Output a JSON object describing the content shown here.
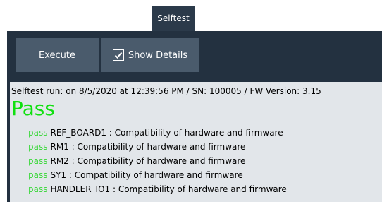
{
  "tab": {
    "label": "Selftest"
  },
  "toolbar": {
    "execute_label": "Execute",
    "show_details_label": "Show Details",
    "show_details_checked": true
  },
  "result": {
    "run_info": "Selftest run: on 8/5/2020 at 12:39:56 PM / SN: 100005 / FW Version: 3.15",
    "verdict": "Pass",
    "verdict_color": "#10e010",
    "items": [
      {
        "status": "pass",
        "text": "REF_BOARD1 : Compatibility of hardware and firmware"
      },
      {
        "status": "pass",
        "text": "RM1 : Compatibility of hardware and firmware"
      },
      {
        "status": "pass",
        "text": "RM2 : Compatibility of hardware and firmware"
      },
      {
        "status": "pass",
        "text": "SY1 : Compatibility of hardware and firmware"
      },
      {
        "status": "pass",
        "text": "HANDLER_IO1 : Compatibility of hardware and firmware"
      }
    ]
  },
  "colors": {
    "panel_bg": "#233140",
    "button_bg": "#4a5b6c",
    "content_bg": "#e2e6ea",
    "pass_text": "#3fd83f"
  }
}
